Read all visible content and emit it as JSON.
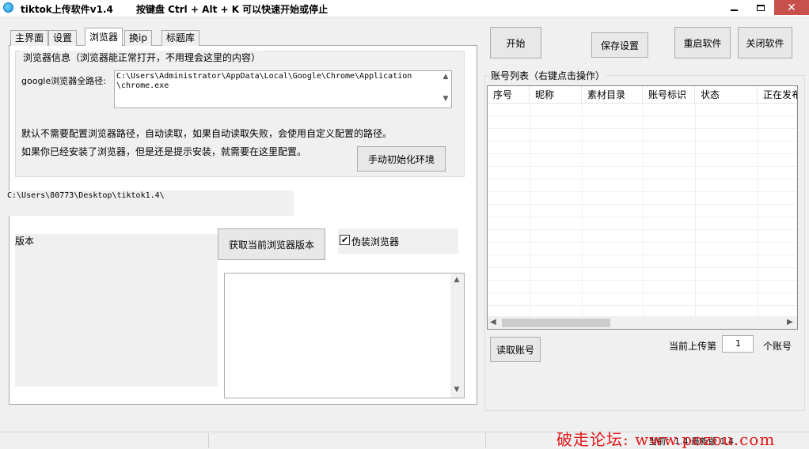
{
  "window": {
    "title": "tiktok上传软件v1.4",
    "hotkey_hint": "按键盘 Ctrl + Alt + K  可以快速开始或停止",
    "close_symbol": "✕"
  },
  "tabs": [
    {
      "label": "主界面"
    },
    {
      "label": "设置"
    },
    {
      "label": "浏览器"
    },
    {
      "label": "换ip"
    },
    {
      "label": "标题库"
    }
  ],
  "active_tab": "浏览器",
  "browser_panel": {
    "group_title": "浏览器信息（浏览器能正常打开，不用理会这里的内容）",
    "chrome_path_label": "google浏览器全路径:",
    "chrome_path_value": "C:\\Users\\Administrator\\AppData\\Local\\Google\\Chrome\\Application\n\\chrome.exe",
    "info_line1": "默认不需要配置浏览器路径，自动读取，如果自动读取失败，会使用自定义配置的路径。",
    "info_line2": "如果你已经安装了浏览器，但是还是提示安装，就需要在这里配置。",
    "init_env_button": "手动初始化环境",
    "desktop_path": "C:\\Users\\80773\\Desktop\\tiktok1.4\\",
    "version_label": "版本",
    "get_version_button": "获取当前浏览器版本",
    "fake_browser_label": "伪装浏览器",
    "fake_browser_checked": true,
    "check_mark": "✔",
    "log_text": ""
  },
  "toolbar": {
    "start": "开始",
    "save_settings": "保存设置",
    "restart": "重启软件",
    "close_app": "关闭软件"
  },
  "accounts": {
    "group_title": "账号列表（右键点击操作）",
    "columns": [
      "序号",
      "昵称",
      "素材目录",
      "账号标识",
      "状态",
      "正在发布"
    ],
    "rows": [],
    "read_button": "读取账号",
    "upload_prefix": "当前上传第",
    "upload_index": "1",
    "upload_suffix": "个账号"
  },
  "status": {
    "version_text": "当前：1.4  最新版 1.4"
  },
  "watermark": "破走论坛: www.pozou.com",
  "icons": {
    "up": "▲",
    "down": "▼",
    "left": "◀",
    "right": "▶"
  },
  "colors": {
    "close_button": "#c7504a",
    "watermark": "#e01818"
  }
}
